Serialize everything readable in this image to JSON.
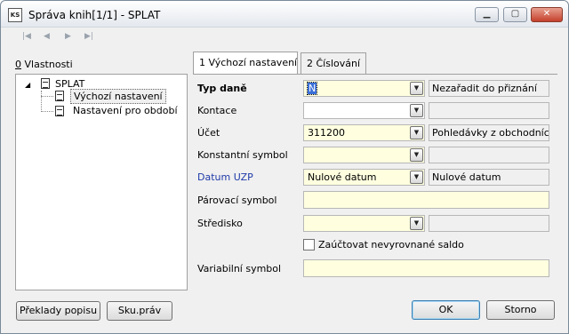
{
  "window": {
    "app_icon_text": "KS",
    "title": "Správa knih[1/1] - SPLAT"
  },
  "navigator": {
    "first": "|◀",
    "prev": "◀",
    "next": "▶",
    "last": "▶|"
  },
  "properties": {
    "label": "Vlastnosti",
    "label_accel": "0",
    "tree": [
      {
        "label": "SPLAT"
      },
      {
        "label": "Výchozí nastavení"
      },
      {
        "label": "Nastavení pro období"
      }
    ]
  },
  "tabs": [
    {
      "label": "1 Výchozí nastavení"
    },
    {
      "label": "2 Číslování"
    }
  ],
  "form": {
    "typ_dane": {
      "label": "Typ daně",
      "value": "N",
      "desc": "Nezařadit do  přiznání"
    },
    "kontace": {
      "label": "Kontace",
      "value": "",
      "desc": ""
    },
    "ucet": {
      "label": "Účet",
      "value": "311200",
      "desc": "Pohledávky z obchodních v:"
    },
    "konstantni_symbol": {
      "label": "Konstantní symbol",
      "value": "",
      "desc": ""
    },
    "datum_uzp": {
      "label": "Datum UZP",
      "value": "Nulové datum",
      "desc": "Nulové datum"
    },
    "parovaci_symbol": {
      "label": "Párovací symbol",
      "value": ""
    },
    "stredisko": {
      "label": "Středisko",
      "value": "",
      "desc": ""
    },
    "zauctovat": {
      "label": "Zaúčtovat nevyrovnané saldo",
      "checked": false
    },
    "variabilni_symbol": {
      "label": "Variabilní symbol",
      "value": ""
    }
  },
  "buttons": {
    "preklady": "Překlady popisu",
    "skuprav": "Sku.práv",
    "ok": "OK",
    "storno": "Storno"
  },
  "colors": {
    "required_field": "#ffffe0",
    "link_label": "#1f3aa8"
  }
}
